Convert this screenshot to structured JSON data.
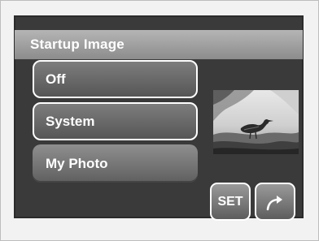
{
  "menu": {
    "title": "Startup Image",
    "items": [
      {
        "label": "Off"
      },
      {
        "label": "System"
      },
      {
        "label": "My Photo"
      }
    ],
    "selected_index": 2
  },
  "buttons": {
    "set_label": "SET",
    "return_icon": "return-arrow-icon"
  },
  "preview": {
    "icon": "bird-photo-thumbnail"
  },
  "colors": {
    "screen_bg": "#3a3a3a",
    "title_bar": "#9e9e9e",
    "text": "#ffffff"
  }
}
